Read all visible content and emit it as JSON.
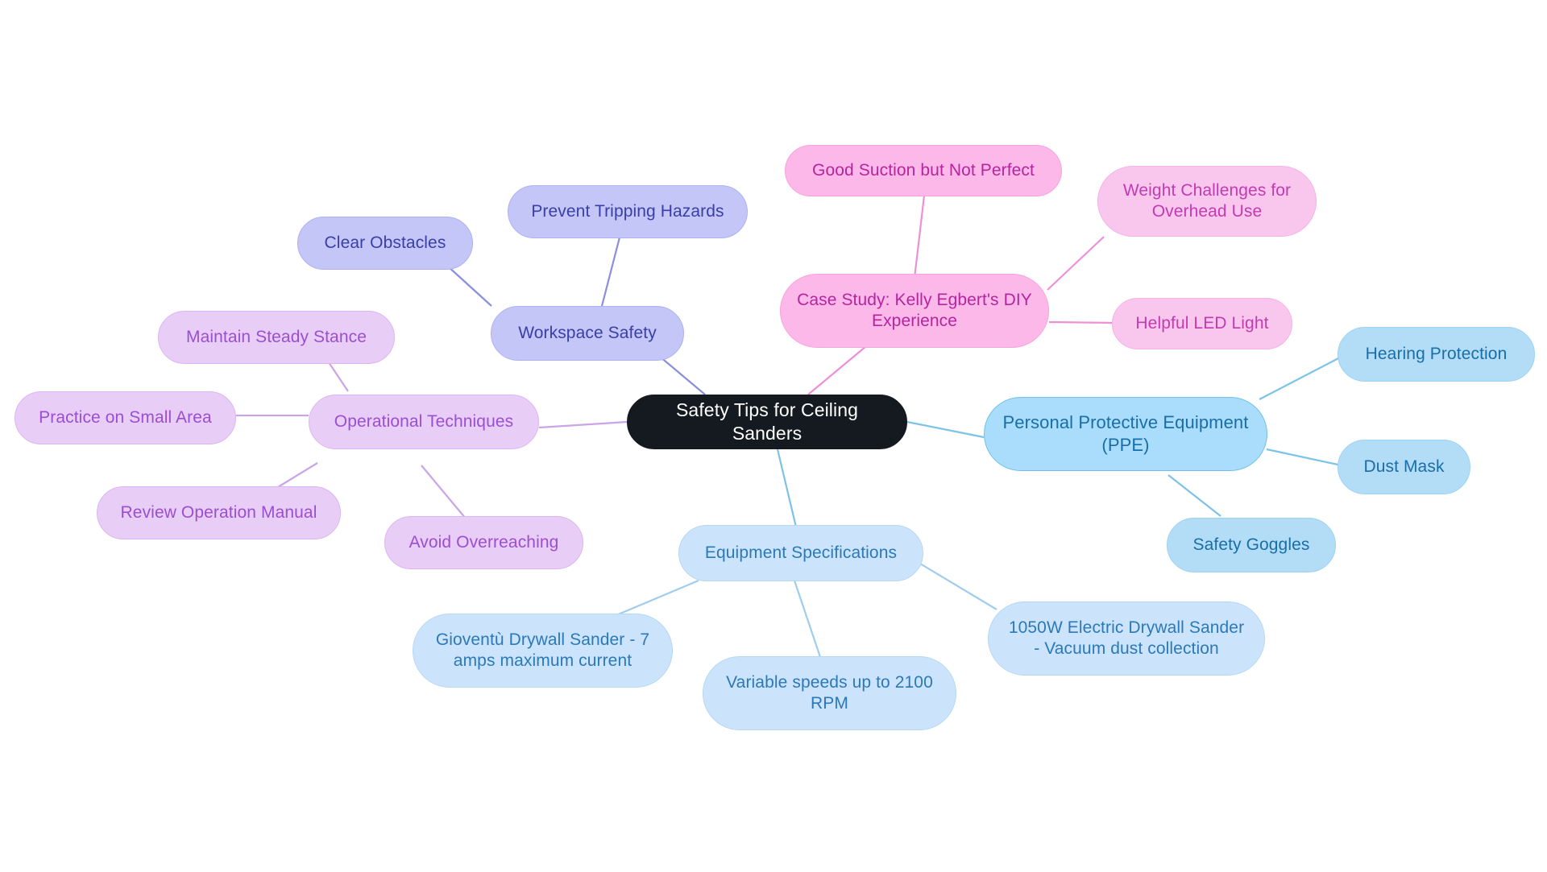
{
  "diagram": {
    "type": "mindmap",
    "title": "Safety Tips for Ceiling Sanders",
    "background": "#ffffff",
    "palette": {
      "root_fill": "#141a1f",
      "root_text": "#ffffff",
      "blue_fill": "#a9ddfb",
      "blue_text": "#1a6ea8",
      "blue_light_fill": "#cce4fb",
      "blue_light_text": "#2b79b8",
      "pink_fill": "#fbb8e8",
      "pink_text": "#b5259e",
      "pink_soft_fill": "#f9c6ee",
      "pink_soft_text": "#c23bb0",
      "purple_fill": "#e8cdf7",
      "purple_text": "#9b4fd0",
      "indigo_fill": "#c3c6f7",
      "indigo_text": "#3a3fa8"
    }
  },
  "root": {
    "id": "root",
    "label": "Safety Tips for Ceiling Sanders"
  },
  "branches": [
    {
      "id": "ppe",
      "label": "Personal Protective Equipment\n(PPE)",
      "color": "#a9ddfb",
      "children": [
        {
          "id": "hearing-protection",
          "label": "Hearing Protection"
        },
        {
          "id": "dust-mask",
          "label": "Dust Mask"
        },
        {
          "id": "safety-goggles",
          "label": "Safety Goggles"
        }
      ]
    },
    {
      "id": "equipment-specifications",
      "label": "Equipment Specifications",
      "color": "#cce4fb",
      "children": [
        {
          "id": "gioventu-sander",
          "label": "Gioventù Drywall Sander - 7\namps maximum current"
        },
        {
          "id": "variable-speeds",
          "label": "Variable speeds up to 2100\nRPM"
        },
        {
          "id": "electric-sander-1050w",
          "label": "1050W Electric Drywall Sander\n- Vacuum dust collection"
        }
      ]
    },
    {
      "id": "case-study",
      "label": "Case Study: Kelly Egbert's DIY\nExperience",
      "color": "#fbb8e8",
      "children": [
        {
          "id": "good-suction",
          "label": "Good Suction but Not Perfect"
        },
        {
          "id": "weight-challenges",
          "label": "Weight Challenges for\nOverhead Use"
        },
        {
          "id": "helpful-led-light",
          "label": "Helpful LED Light"
        }
      ]
    },
    {
      "id": "workspace-safety",
      "label": "Workspace Safety",
      "color": "#c3c6f7",
      "children": [
        {
          "id": "prevent-tripping-hazards",
          "label": "Prevent Tripping Hazards"
        },
        {
          "id": "clear-obstacles",
          "label": "Clear Obstacles"
        }
      ]
    },
    {
      "id": "operational-techniques",
      "label": "Operational Techniques",
      "color": "#e8cdf7",
      "children": [
        {
          "id": "maintain-steady-stance",
          "label": "Maintain Steady Stance"
        },
        {
          "id": "practice-small-area",
          "label": "Practice on Small Area"
        },
        {
          "id": "review-operation-manual",
          "label": "Review Operation Manual"
        },
        {
          "id": "avoid-overreaching",
          "label": "Avoid Overreaching"
        }
      ]
    }
  ]
}
